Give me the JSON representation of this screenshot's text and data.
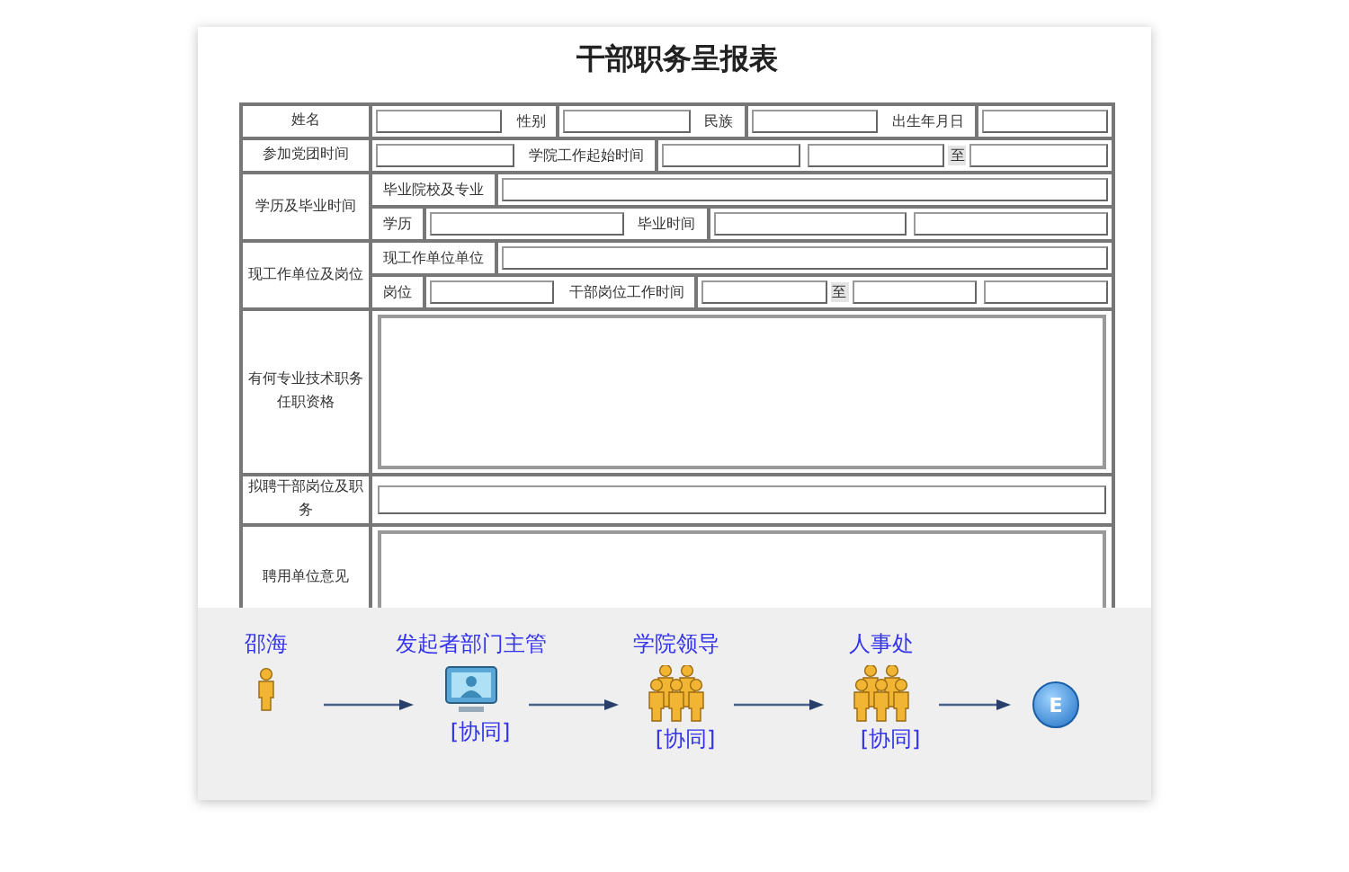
{
  "form": {
    "title": "干部职务呈报表",
    "sections": [
      {
        "label": "姓名",
        "kind": "line",
        "lines": [
          [
            {
              "kind": "field"
            },
            {
              "kind": "label",
              "text": "性别"
            },
            {
              "kind": "field"
            },
            {
              "kind": "label",
              "text": "民族"
            },
            {
              "kind": "field"
            },
            {
              "kind": "label",
              "text": "出生年月日"
            },
            {
              "kind": "field"
            }
          ]
        ]
      },
      {
        "label": "参加党团时间",
        "kind": "line",
        "lines": [
          [
            {
              "kind": "field"
            },
            {
              "kind": "label",
              "text": "学院工作起始时间"
            },
            {
              "kind": "field"
            },
            {
              "kind": "field"
            },
            {
              "kind": "to",
              "text": "至"
            },
            {
              "kind": "field"
            }
          ]
        ]
      },
      {
        "label": "学历及毕业时间",
        "kind": "line",
        "lines": [
          [
            {
              "kind": "label",
              "text": "毕业院校及专业"
            },
            {
              "kind": "field"
            }
          ],
          [
            {
              "kind": "label",
              "text": "学历"
            },
            {
              "kind": "field"
            },
            {
              "kind": "label",
              "text": "毕业时间"
            },
            {
              "kind": "field"
            },
            {
              "kind": "field"
            }
          ]
        ]
      },
      {
        "label": "现工作单位及岗位",
        "kind": "line",
        "lines": [
          [
            {
              "kind": "label",
              "text": "现工作单位单位"
            },
            {
              "kind": "field"
            }
          ],
          [
            {
              "kind": "label",
              "text": "岗位"
            },
            {
              "kind": "field"
            },
            {
              "kind": "label",
              "text": "干部岗位工作时间"
            },
            {
              "kind": "field"
            },
            {
              "kind": "to",
              "text": "至"
            },
            {
              "kind": "field"
            },
            {
              "kind": "field"
            }
          ]
        ]
      },
      {
        "label": "有何专业技术职务任职资格",
        "kind": "area"
      },
      {
        "label": "拟聘干部岗位及职务",
        "kind": "single"
      },
      {
        "label": "聘用单位意见",
        "kind": "area"
      }
    ]
  },
  "flow": [
    {
      "name": "邵海",
      "kind": "person"
    },
    {
      "name": "发起者部门主管",
      "kind": "monitor",
      "tag": "[协同]"
    },
    {
      "name": "学院领导",
      "kind": "group",
      "tag": "[协同]"
    },
    {
      "name": "人事处",
      "kind": "group",
      "tag": "[协同]"
    },
    {
      "kind": "end",
      "text": "E"
    }
  ]
}
